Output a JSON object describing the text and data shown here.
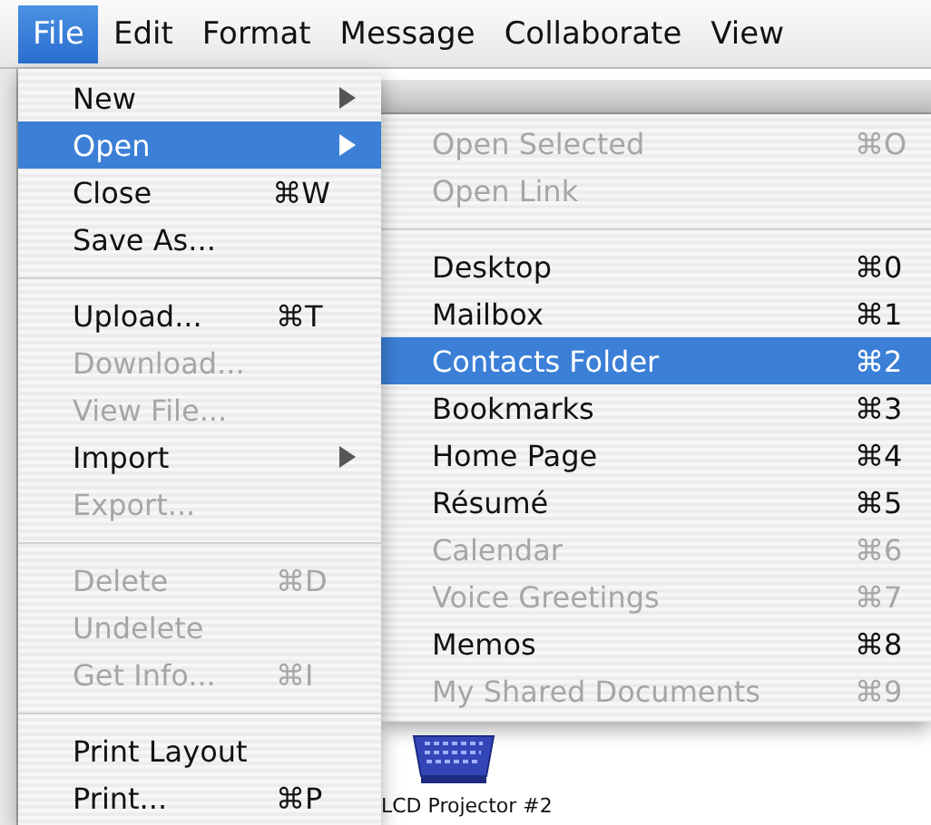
{
  "menubar": [
    {
      "label": "File",
      "selected": true
    },
    {
      "label": "Edit",
      "selected": false
    },
    {
      "label": "Format",
      "selected": false
    },
    {
      "label": "Message",
      "selected": false
    },
    {
      "label": "Collaborate",
      "selected": false
    },
    {
      "label": "View",
      "selected": false
    }
  ],
  "file_menu": {
    "items": [
      {
        "kind": "item",
        "label": "New",
        "submenu": true,
        "disabled": false,
        "selected": false
      },
      {
        "kind": "item",
        "label": "Open",
        "submenu": true,
        "disabled": false,
        "selected": true
      },
      {
        "kind": "item",
        "label": "Close",
        "shortcut": "⌘W",
        "disabled": false,
        "selected": false
      },
      {
        "kind": "item",
        "label": "Save As...",
        "disabled": false,
        "selected": false
      },
      {
        "kind": "separator"
      },
      {
        "kind": "item",
        "label": "Upload...",
        "shortcut": "⌘T",
        "disabled": false,
        "selected": false
      },
      {
        "kind": "item",
        "label": "Download...",
        "disabled": true,
        "selected": false
      },
      {
        "kind": "item",
        "label": "View File...",
        "disabled": true,
        "selected": false
      },
      {
        "kind": "item",
        "label": "Import",
        "submenu": true,
        "disabled": false,
        "selected": false
      },
      {
        "kind": "item",
        "label": "Export...",
        "disabled": true,
        "selected": false
      },
      {
        "kind": "separator"
      },
      {
        "kind": "item",
        "label": "Delete",
        "shortcut": "⌘D",
        "disabled": true,
        "selected": false
      },
      {
        "kind": "item",
        "label": "Undelete",
        "disabled": true,
        "selected": false
      },
      {
        "kind": "item",
        "label": "Get Info...",
        "shortcut": "⌘I",
        "disabled": true,
        "selected": false
      },
      {
        "kind": "separator"
      },
      {
        "kind": "item",
        "label": "Print Layout",
        "disabled": false,
        "selected": false
      },
      {
        "kind": "item",
        "label": "Print...",
        "shortcut": "⌘P",
        "disabled": false,
        "selected": false
      }
    ]
  },
  "open_submenu": {
    "items": [
      {
        "kind": "item",
        "label": "Open Selected",
        "shortcut": "⌘O",
        "disabled": true,
        "selected": false
      },
      {
        "kind": "item",
        "label": "Open Link",
        "disabled": true,
        "selected": false
      },
      {
        "kind": "separator"
      },
      {
        "kind": "item",
        "label": "Desktop",
        "shortcut": "⌘0",
        "disabled": false,
        "selected": false
      },
      {
        "kind": "item",
        "label": "Mailbox",
        "shortcut": "⌘1",
        "disabled": false,
        "selected": false
      },
      {
        "kind": "item",
        "label": "Contacts Folder",
        "shortcut": "⌘2",
        "disabled": false,
        "selected": true
      },
      {
        "kind": "item",
        "label": "Bookmarks",
        "shortcut": "⌘3",
        "disabled": false,
        "selected": false
      },
      {
        "kind": "item",
        "label": "Home Page",
        "shortcut": "⌘4",
        "disabled": false,
        "selected": false
      },
      {
        "kind": "item",
        "label": "Résumé",
        "shortcut": "⌘5",
        "disabled": false,
        "selected": false
      },
      {
        "kind": "item",
        "label": "Calendar",
        "shortcut": "⌘6",
        "disabled": true,
        "selected": false
      },
      {
        "kind": "item",
        "label": "Voice Greetings",
        "shortcut": "⌘7",
        "disabled": true,
        "selected": false
      },
      {
        "kind": "item",
        "label": "Memos",
        "shortcut": "⌘8",
        "disabled": false,
        "selected": false
      },
      {
        "kind": "item",
        "label": "My Shared Documents",
        "shortcut": "⌘9",
        "disabled": true,
        "selected": false
      }
    ]
  },
  "desktop": {
    "icon_label": "LCD Projector #2"
  }
}
